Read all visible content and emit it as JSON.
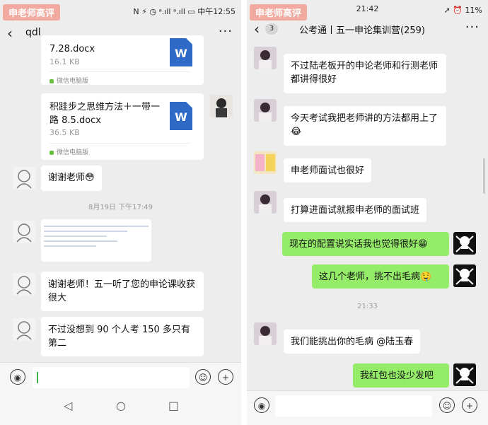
{
  "left": {
    "brand": "申老师高评",
    "status_right": "N ⚡ ◷ ᵃ.ıll ᵃ.ıll ▭ 中午12:55",
    "contact": "qdl",
    "files": [
      {
        "name": "7.28.docx",
        "size": "16.1 KB",
        "source": "微信电脑版"
      },
      {
        "name": "积跬步之思维方法＋一带一路 8.5.docx",
        "size": "36.5 KB",
        "source": "微信电脑版"
      }
    ],
    "messages": [
      {
        "text": "谢谢老师😳"
      },
      {
        "text": "谢谢老师！五一听了您的申论课收获很大"
      },
      {
        "text": "不过没想到 90 个人考 150 多只有第二"
      }
    ],
    "timestamp": "8月19日 下午17:49",
    "word_icon": "W"
  },
  "right": {
    "brand": "申老师高评",
    "status_time": "21:42",
    "status_right": "➚ ⏰ 11%",
    "back_count": "3",
    "group_title": "公考通丨五一申论集训营(259)",
    "messages": [
      {
        "text": "不过陆老板开的申论老师和行测老师都讲得很好",
        "side": "left"
      },
      {
        "text": "今天考试我把老师讲的方法都用上了😂",
        "side": "left"
      },
      {
        "text": "申老师面试也很好",
        "side": "left"
      },
      {
        "text": "打算进面试就报申老师的面试班",
        "side": "left"
      },
      {
        "text": "现在的配置说实话我也觉得很好😁",
        "side": "right"
      },
      {
        "text": "这几个老师，挑不出毛病🤤",
        "side": "right"
      },
      {
        "text": "我们能挑出你的毛病 @陆玉春",
        "side": "left"
      },
      {
        "text": "我红包也没少发吧",
        "side": "right"
      }
    ],
    "timestamp": "21:33"
  },
  "icons": {
    "back": "‹",
    "more": "···",
    "voice": "◉",
    "emoji": "☺",
    "plus": "+",
    "nav_back": "◁",
    "nav_home": "○",
    "nav_recent": "□"
  }
}
